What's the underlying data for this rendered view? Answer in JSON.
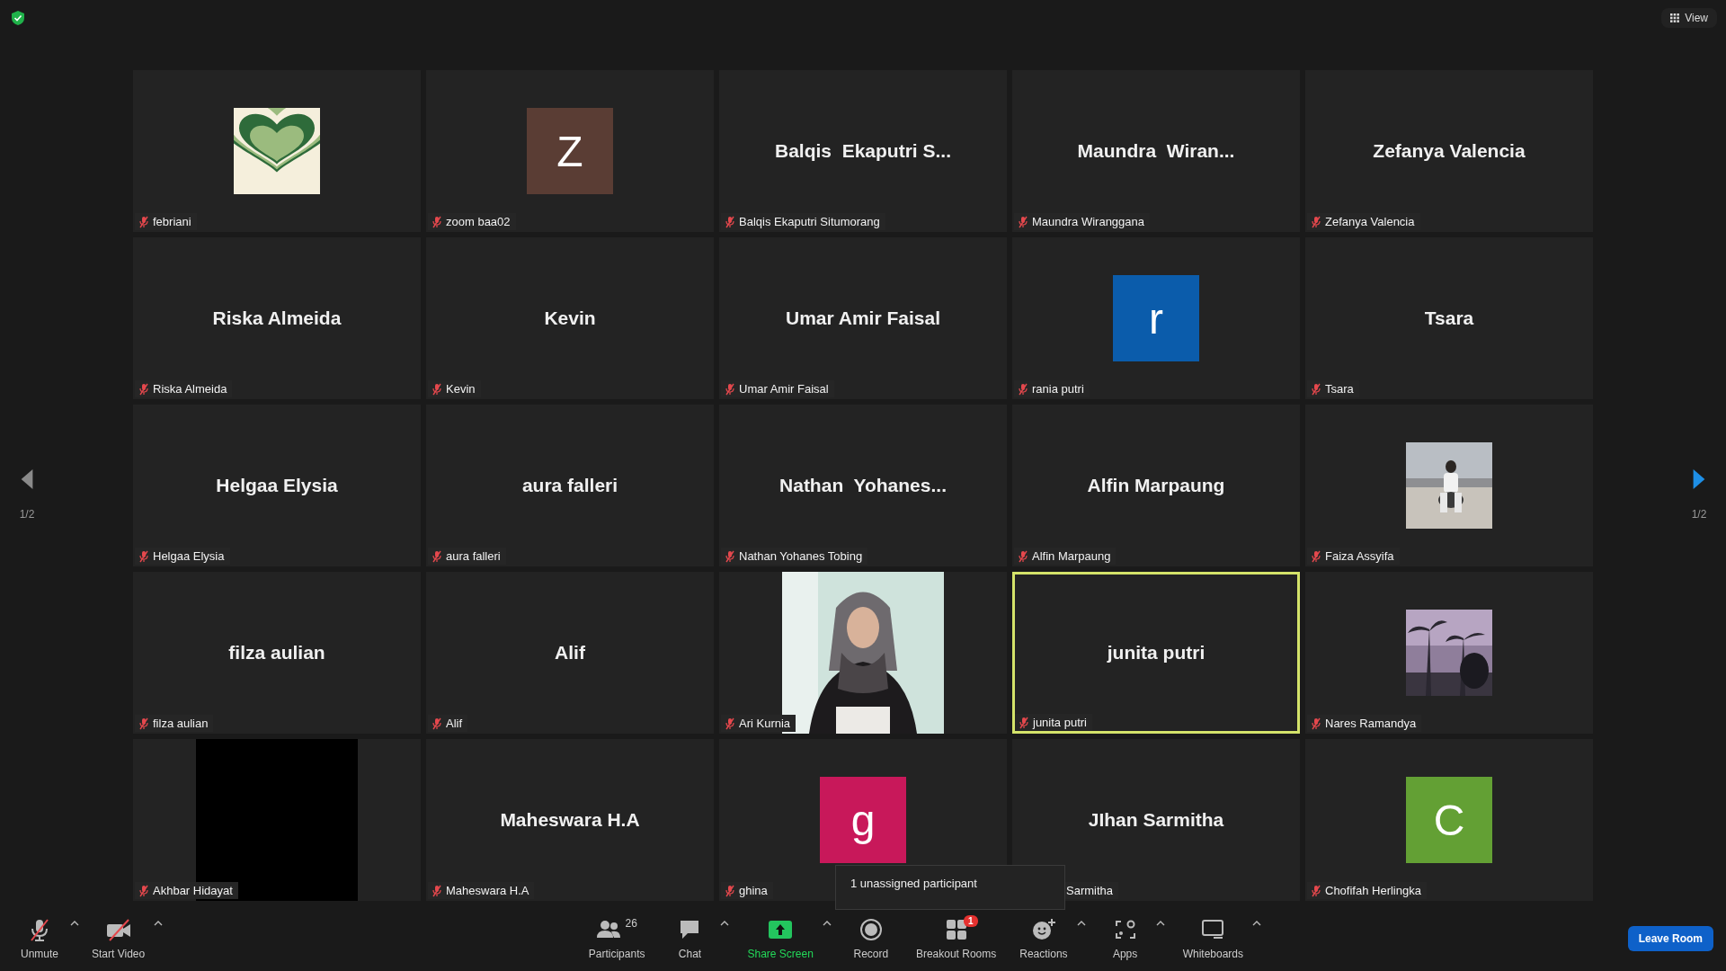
{
  "top_bar": {
    "view_button": {
      "label": "View"
    }
  },
  "pagination": {
    "prev": {
      "page": "1/2",
      "disabled": true
    },
    "next": {
      "page": "1/2",
      "disabled": false
    }
  },
  "tiles": [
    {
      "label": "febriani",
      "active": false
    },
    {
      "display": {
        "kind": "initial",
        "letter": "Z",
        "color": "#5a3d34"
      },
      "label": "zoom baa02",
      "active": false
    },
    {
      "display": {
        "kind": "name",
        "text": "Balqis  Ekaputri S..."
      },
      "label": "Balqis Ekaputri Situmorang",
      "active": false
    },
    {
      "display": {
        "kind": "name",
        "text": "Maundra  Wiran..."
      },
      "label": "Maundra Wiranggana",
      "active": false
    },
    {
      "display": {
        "kind": "name",
        "text": "Zefanya Valencia"
      },
      "label": "Zefanya Valencia",
      "active": false
    },
    {
      "display": {
        "kind": "name",
        "text": "Riska Almeida"
      },
      "label": "Riska Almeida",
      "active": false
    },
    {
      "display": {
        "kind": "name",
        "text": "Kevin"
      },
      "label": "Kevin",
      "active": false
    },
    {
      "display": {
        "kind": "name",
        "text": "Umar Amir Faisal"
      },
      "label": "Umar Amir Faisal",
      "active": false
    },
    {
      "display": {
        "kind": "initial",
        "letter": "r",
        "color": "#0b5cab"
      },
      "label": "rania putri",
      "active": false
    },
    {
      "display": {
        "kind": "name",
        "text": "Tsara"
      },
      "label": "Tsara",
      "active": false
    },
    {
      "display": {
        "kind": "name",
        "text": "Helgaa Elysia"
      },
      "label": "Helgaa Elysia",
      "active": false
    },
    {
      "display": {
        "kind": "name",
        "text": "aura falleri"
      },
      "label": "aura falleri",
      "active": false
    },
    {
      "display": {
        "kind": "name",
        "text": "Nathan  Yohanes..."
      },
      "label": "Nathan Yohanes Tobing",
      "active": false
    },
    {
      "display": {
        "kind": "name",
        "text": "Alfin Marpaung"
      },
      "label": "Alfin Marpaung",
      "active": false
    },
    {
      "label": "Faiza Assyifa",
      "active": false
    },
    {
      "display": {
        "kind": "name",
        "text": "filza aulian"
      },
      "label": "filza aulian",
      "active": false
    },
    {
      "display": {
        "kind": "name",
        "text": "Alif"
      },
      "label": "Alif",
      "active": false
    },
    {
      "display": {
        "kind": "video"
      },
      "label": "Ari Kurnia",
      "active": false
    },
    {
      "display": {
        "kind": "name",
        "text": "junita putri"
      },
      "label": "junita putri",
      "active": true
    },
    {
      "label": "Nares Ramandya",
      "active": false
    },
    {
      "display": {
        "kind": "blank"
      },
      "label": "Akhbar Hidayat",
      "active": false
    },
    {
      "display": {
        "kind": "name",
        "text": "Maheswara H.A"
      },
      "label": "Maheswara H.A",
      "active": false
    },
    {
      "display": {
        "kind": "initial",
        "letter": "g",
        "color": "#c8185a"
      },
      "label": "ghina",
      "active": false
    },
    {
      "display": {
        "kind": "name",
        "text": "JIhan Sarmitha"
      },
      "label": "Sarmitha",
      "active": false,
      "label_obscured": true
    },
    {
      "display": {
        "kind": "initial",
        "letter": "C",
        "color": "#63a034"
      },
      "label": "Chofifah Herlingka",
      "active": false
    }
  ],
  "tooltip": {
    "text": "1 unassigned participant"
  },
  "toolbar": {
    "left": [
      {
        "kind": "mic",
        "label": "Unmute",
        "off": true,
        "caret": true
      },
      {
        "kind": "video",
        "label": "Start Video",
        "off": true,
        "caret": true
      }
    ],
    "center": [
      {
        "kind": "participants",
        "label": "Participants",
        "count": "26",
        "caret": false
      },
      {
        "kind": "chat",
        "label": "Chat",
        "caret": true
      },
      {
        "kind": "share",
        "label": "Share Screen",
        "caret": true
      },
      {
        "kind": "record",
        "label": "Record",
        "caret": false
      },
      {
        "kind": "breakout",
        "label": "Breakout Rooms",
        "badge": "1",
        "caret": false
      },
      {
        "kind": "reactions",
        "label": "Reactions",
        "caret": true
      },
      {
        "kind": "apps",
        "label": "Apps",
        "caret": true
      },
      {
        "kind": "whiteboards",
        "label": "Whiteboards",
        "caret": true
      }
    ],
    "leave_button": {
      "label": "Leave Room"
    }
  }
}
